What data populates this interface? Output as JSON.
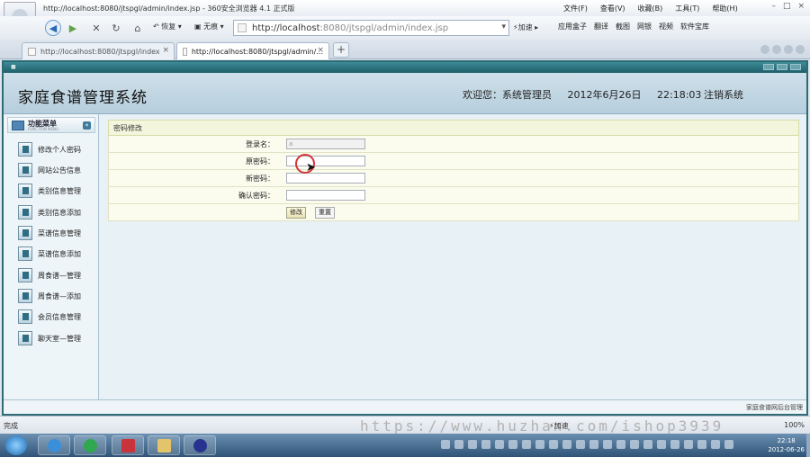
{
  "window": {
    "title": "http://localhost:8080/jtspgl/admin/index.jsp - 360安全浏览器 4.1 正式版",
    "menus": [
      "文件(F)",
      "查看(V)",
      "收藏(B)",
      "工具(T)",
      "帮助(H)"
    ],
    "controls": [
      "–",
      "□",
      "×"
    ]
  },
  "toolbar": {
    "back_icon": "back-arrow-icon",
    "forward_icon": "forward-arrow-icon",
    "restore_label": "恢复",
    "nosign_label": "无痕",
    "address_prefix": "http://localhost",
    "address_rest": ":8080/jtspgl/admin/index.jsp",
    "accelerate_label": "加速",
    "right_items": [
      "应用盒子",
      "翻译",
      "截图",
      "网银",
      "视频",
      "软件宝库"
    ]
  },
  "tabs": [
    {
      "label": "http://localhost:8080/jtspgl/index",
      "active": false
    },
    {
      "label": "http://localhost:8080/jtspgl/admin/...",
      "active": true
    }
  ],
  "page": {
    "system_title": "家庭食谱管理系统",
    "welcome": "欢迎您：系统管理员",
    "date": "2012年6月26日",
    "time": "22:18:03",
    "logout": "注销系统",
    "footer_text": "家庭食谱网后台管理"
  },
  "sidebar": {
    "header": "功能菜单",
    "header_sub": "FUNCTION MENU",
    "items": [
      {
        "label": "修改个人密码"
      },
      {
        "label": "网站公告信息"
      },
      {
        "label": "类别信息管理"
      },
      {
        "label": "类别信息添加"
      },
      {
        "label": "菜谱信息管理"
      },
      {
        "label": "菜谱信息添加"
      },
      {
        "label": "周食谱—管理"
      },
      {
        "label": "周食谱—添加"
      },
      {
        "label": "会员信息管理"
      },
      {
        "label": "聊天室—管理"
      }
    ]
  },
  "form": {
    "title": "密码修改",
    "fields": [
      {
        "label": "登录名：",
        "value": "a"
      },
      {
        "label": "原密码：",
        "value": ""
      },
      {
        "label": "新密码：",
        "value": ""
      },
      {
        "label": "确认密码：",
        "value": ""
      }
    ],
    "submit_label": "修改",
    "reset_label": "重置"
  },
  "statusbar": {
    "status": "完成",
    "watermark": "https://www.huzhan.com/ishop3939",
    "speed_label": "加速",
    "zoom": "100%"
  },
  "taskbar": {
    "clock_time": "22:18",
    "clock_date": "2012-06-26"
  }
}
